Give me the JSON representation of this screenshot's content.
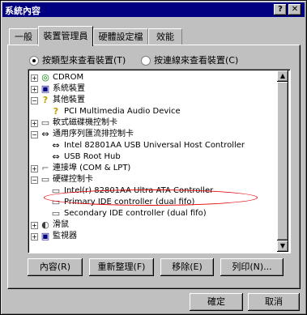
{
  "window": {
    "title": "系統內容",
    "help_button": "?",
    "close_button": "✕"
  },
  "tabs": [
    {
      "label": "一般"
    },
    {
      "label": "裝置管理員"
    },
    {
      "label": "硬體設定檔"
    },
    {
      "label": "效能"
    }
  ],
  "view": {
    "by_type": "按類型來查看裝置(T)",
    "by_connection": "按連線來查看裝置(C)",
    "selected": "by_type"
  },
  "tree": [
    {
      "label": "CDROM",
      "icon": "cdrom-icon",
      "expander": "+"
    },
    {
      "label": "系統裝置",
      "icon": "computer-icon",
      "expander": "+"
    },
    {
      "label": "其他裝置",
      "icon": "question-icon",
      "expander": "−"
    },
    {
      "label": "PCI Multimedia Audio Device",
      "icon": "unknown-device-icon",
      "expander": ""
    },
    {
      "label": "軟式磁碟機控制卡",
      "icon": "controller-icon",
      "expander": "+"
    },
    {
      "label": "通用序列匯流排控制卡",
      "icon": "usb-icon",
      "expander": "−"
    },
    {
      "label": "Intel 82801AA USB Universal Host Controller",
      "icon": "usb-icon",
      "expander": ""
    },
    {
      "label": "USB Root Hub",
      "icon": "usb-icon",
      "expander": ""
    },
    {
      "label": "連接埠 (COM & LPT)",
      "icon": "port-icon",
      "expander": "+"
    },
    {
      "label": "硬碟控制卡",
      "icon": "controller-icon",
      "expander": "−"
    },
    {
      "label": "Intel(r) 82801AA Ultra ATA Controller",
      "icon": "controller-icon",
      "expander": ""
    },
    {
      "label": "Primary IDE controller (dual fifo)",
      "icon": "controller-icon",
      "expander": ""
    },
    {
      "label": "Secondary IDE controller (dual fifo)",
      "icon": "controller-icon",
      "expander": ""
    },
    {
      "label": "滑鼠",
      "icon": "mouse-icon",
      "expander": "+"
    },
    {
      "label": "監視器",
      "icon": "monitor-icon",
      "expander": "+"
    }
  ],
  "actions": {
    "properties": "內容(R)",
    "refresh": "重新整理(F)",
    "remove": "移除(E)",
    "print": "列印(N)..."
  },
  "footer": {
    "ok": "確定",
    "cancel": "取消"
  }
}
